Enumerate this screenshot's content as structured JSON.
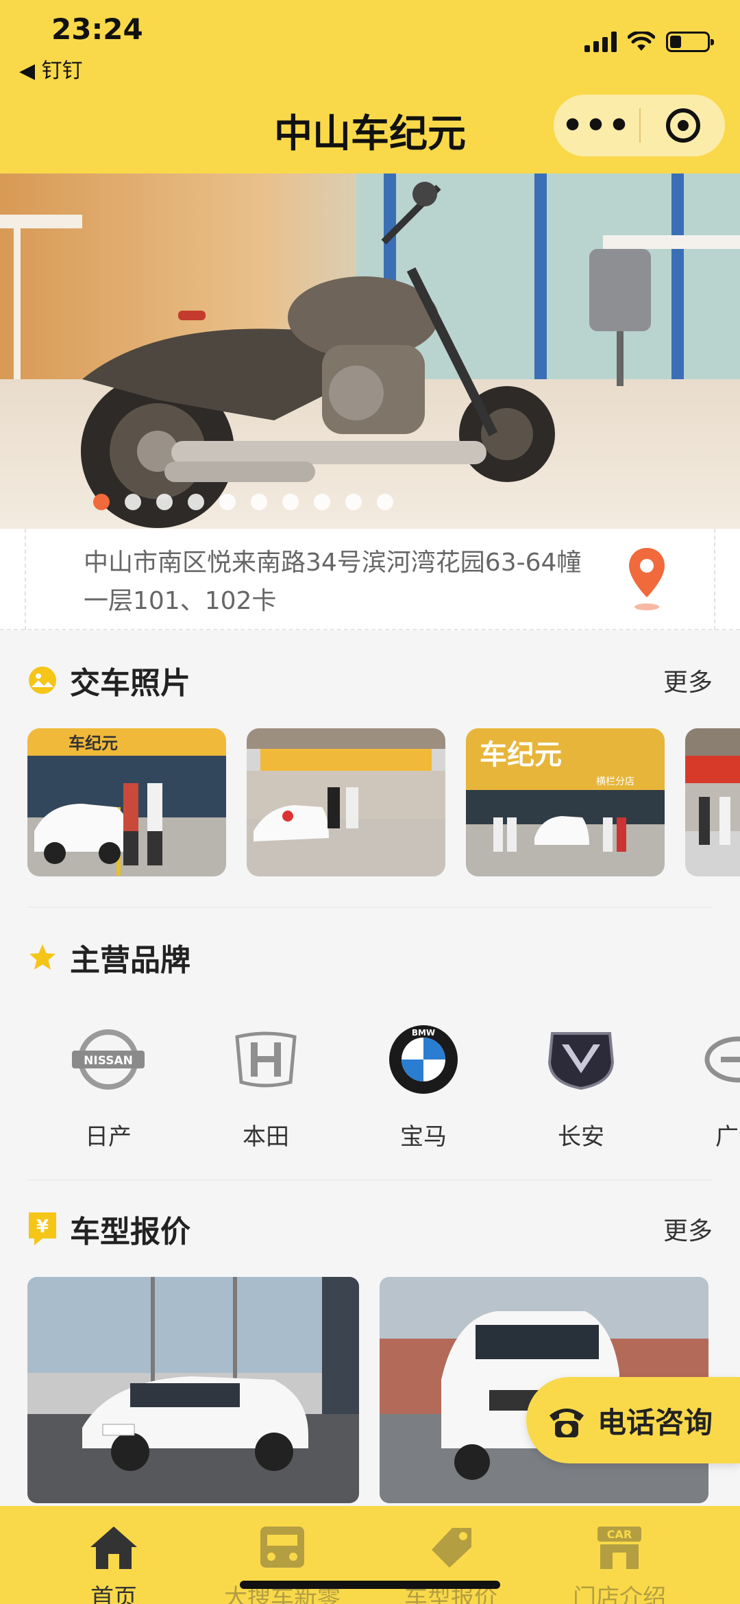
{
  "status": {
    "time": "23:24",
    "back_app": "◀ 钉钉"
  },
  "header": {
    "title": "中山车纪元",
    "menu_dots": "•••"
  },
  "banner": {
    "total_slides": 10,
    "active_slide": 1
  },
  "address": {
    "text": "中山市南区悦来南路34号滨河湾花园63-64幢一层101、102卡"
  },
  "delivery_photos": {
    "title": "交车照片",
    "more": "更多",
    "photo_count": 4,
    "sign_text": "车纪元",
    "sign_sub": "横栏分店"
  },
  "brands": {
    "title": "主营品牌",
    "items": [
      {
        "name": "日产",
        "logo_text": "NISSAN"
      },
      {
        "name": "本田",
        "logo_text": "H"
      },
      {
        "name": "宝马",
        "logo_text": "BMW"
      },
      {
        "name": "长安",
        "logo_text": "V"
      },
      {
        "name": "广汽",
        "logo_text": "G"
      }
    ]
  },
  "prices": {
    "title": "车型报价",
    "more": "更多",
    "badge_icon": "¥"
  },
  "call": {
    "label": "电话咨询"
  },
  "tabbar": {
    "items": [
      {
        "label": "首页",
        "active": true
      },
      {
        "label": "大搜车新零售",
        "active": false
      },
      {
        "label": "车型报价",
        "active": false
      },
      {
        "label": "门店介绍",
        "active": false
      }
    ],
    "car_badge": "CAR"
  },
  "colors": {
    "brand_yellow": "#f9d94a",
    "dot_active": "#f06a3c",
    "pin": "#f06a3c"
  }
}
